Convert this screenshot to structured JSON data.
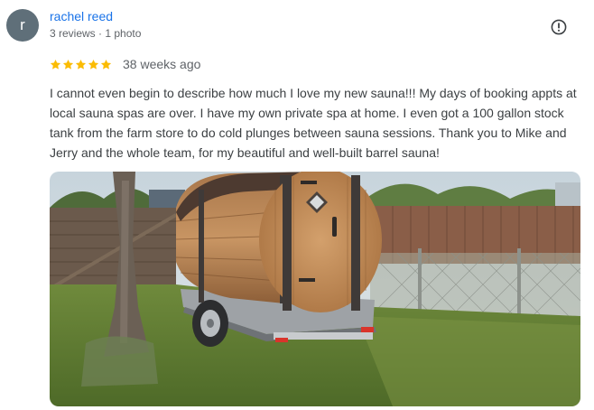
{
  "reviewer": {
    "avatar_letter": "r",
    "name": "rachel reed",
    "meta": "3 reviews · 1 photo"
  },
  "review": {
    "rating": 5,
    "max_rating": 5,
    "time": "38 weeks ago",
    "text": "I cannot even begin to describe how much I love my new sauna!!! My days of booking appts at local sauna spas are over. I have my own private spa at home. I even got a 100 gallon stock tank from the farm store to do cold plunges between sauna sessions. Thank you to Mike and Jerry and the whole team, for my beautiful and well-built barrel sauna!"
  },
  "colors": {
    "name_link": "#1a73e8",
    "star": "#fbbc04",
    "avatar_bg": "#5f6f79"
  },
  "icons": {
    "report": "report-flag-icon",
    "star": "star-icon"
  }
}
